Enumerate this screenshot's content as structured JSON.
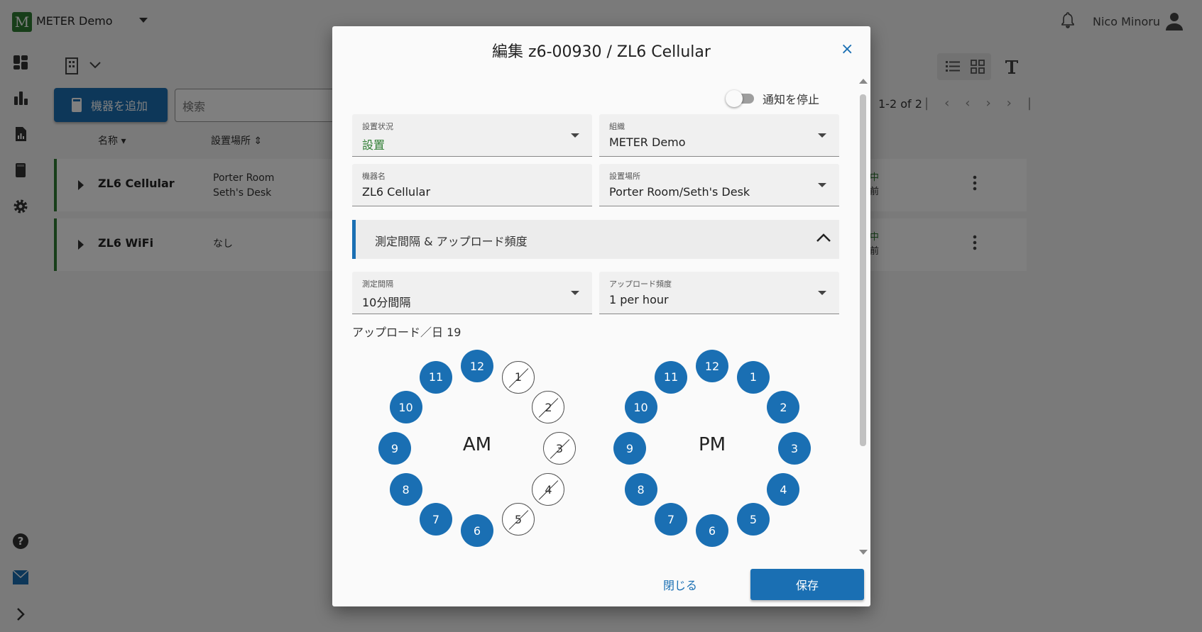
{
  "app": {
    "logo_letter": "M",
    "title": "METER Demo",
    "user_name": "Nico Minoru"
  },
  "main": {
    "add_device_label": "機器を追加",
    "search_placeholder": "検索",
    "columns": {
      "name": "名称",
      "location": "設置場所"
    },
    "pagination": "1-2 of 2",
    "rows": [
      {
        "name": "ZL6 Cellular",
        "location_line1": "Porter Room",
        "location_line2": "Seth's Desk",
        "status_line1": "中",
        "status_line2": "前"
      },
      {
        "name": "ZL6 WiFi",
        "location_line1": "なし",
        "location_line2": "",
        "status_line1": "中",
        "status_line2": "前"
      }
    ]
  },
  "dialog": {
    "title": "編集 z6-00930 / ZL6 Cellular",
    "close_icon": "×",
    "mute_notifications_label": "通知を停止",
    "fields": {
      "status": {
        "label": "設置状況",
        "value": "設置"
      },
      "organization": {
        "label": "組織",
        "value": "METER Demo"
      },
      "device_name": {
        "label": "機器名",
        "value": "ZL6 Cellular"
      },
      "location": {
        "label": "設置場所",
        "value": "Porter Room/Seth's Desk"
      },
      "measurement_interval": {
        "label": "測定間隔",
        "value": "10分間隔"
      },
      "upload_frequency": {
        "label": "アップロード頻度",
        "value": "1 per hour"
      }
    },
    "section_title": "測定間隔 & アップロード頻度",
    "uploads_per_day_label": "アップロード／日 19",
    "am_label": "AM",
    "pm_label": "PM",
    "am_hours": [
      {
        "h": "12",
        "on": true
      },
      {
        "h": "1",
        "on": false
      },
      {
        "h": "2",
        "on": false
      },
      {
        "h": "3",
        "on": false
      },
      {
        "h": "4",
        "on": false
      },
      {
        "h": "5",
        "on": false
      },
      {
        "h": "6",
        "on": true
      },
      {
        "h": "7",
        "on": true
      },
      {
        "h": "8",
        "on": true
      },
      {
        "h": "9",
        "on": true
      },
      {
        "h": "10",
        "on": true
      },
      {
        "h": "11",
        "on": true
      }
    ],
    "pm_hours": [
      {
        "h": "12",
        "on": true
      },
      {
        "h": "1",
        "on": true
      },
      {
        "h": "2",
        "on": true
      },
      {
        "h": "3",
        "on": true
      },
      {
        "h": "4",
        "on": true
      },
      {
        "h": "5",
        "on": true
      },
      {
        "h": "6",
        "on": true
      },
      {
        "h": "7",
        "on": true
      },
      {
        "h": "8",
        "on": true
      },
      {
        "h": "9",
        "on": true
      },
      {
        "h": "10",
        "on": true
      },
      {
        "h": "11",
        "on": true
      }
    ],
    "close_label": "閉じる",
    "save_label": "保存"
  },
  "colors": {
    "primary": "#1a6fb3",
    "green": "#2e7d32"
  }
}
